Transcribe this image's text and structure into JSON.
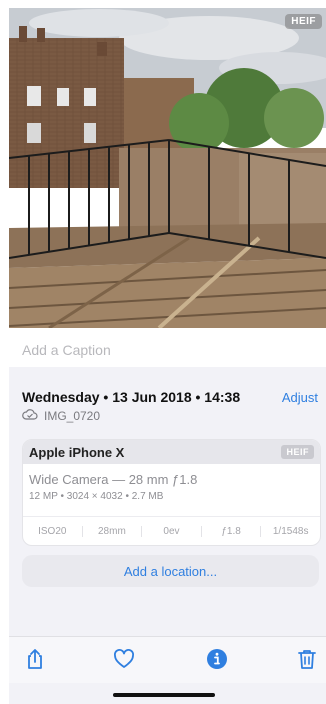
{
  "photo": {
    "format_badge": "HEIF"
  },
  "caption": {
    "placeholder": "Add a Caption"
  },
  "info": {
    "date_line": "Wednesday • 13 Jun 2018 • 14:38",
    "adjust_label": "Adjust",
    "file_name": "IMG_0720"
  },
  "device": {
    "name": "Apple iPhone X",
    "format_badge": "HEIF",
    "lens": "Wide Camera — 28 mm ƒ1.8",
    "specs": "12 MP • 3024 × 4032 • 2.7 MB",
    "exif": [
      "ISO20",
      "28mm",
      "0ev",
      "ƒ1.8",
      "1/1548s"
    ]
  },
  "location": {
    "button_label": "Add a location..."
  },
  "toolbar": {
    "icons": [
      "share-icon",
      "heart-icon",
      "info-icon",
      "trash-icon"
    ],
    "accent_color": "#2f7fe0"
  }
}
